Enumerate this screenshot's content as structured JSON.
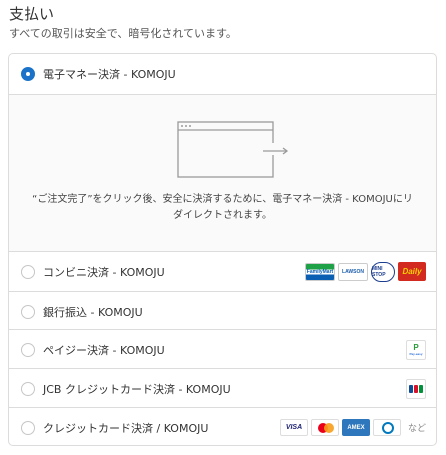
{
  "header": {
    "title": "支払い",
    "subtitle": "すべての取引は安全で、暗号化されています。"
  },
  "payment_methods": [
    {
      "label": "電子マネー決済 - KOMOJU",
      "selected": true
    },
    {
      "label": "コンビニ決済 - KOMOJU",
      "selected": false
    },
    {
      "label": "銀行振込 - KOMOJU",
      "selected": false
    },
    {
      "label": "ペイジー決済 - KOMOJU",
      "selected": false
    },
    {
      "label": "JCB クレジットカード決済 - KOMOJU",
      "selected": false
    },
    {
      "label": "クレジットカード決済 / KOMOJU",
      "selected": false
    }
  ],
  "redirect_notice": "“ご注文完了”をクリック後、安全に決済するために、電子マネー決済 - KOMOJUにリダイレクトされます。",
  "logos": {
    "famima": "FamilyMart",
    "lawson": "LAWSON",
    "ministop": "MINI STOP",
    "daily": "Daily",
    "payeasy": "Pay-easy",
    "visa": "VISA",
    "amex": "AMEX",
    "more": "など"
  },
  "colors": {
    "accent": "#1a73c8",
    "border": "#dcdcdc",
    "detail_bg": "#fafafa"
  }
}
